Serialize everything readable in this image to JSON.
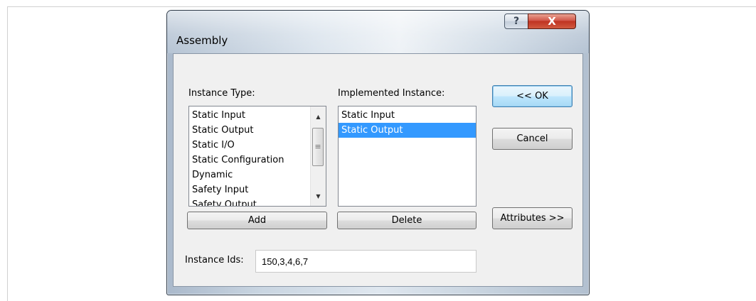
{
  "window": {
    "title": "Assembly",
    "help_label": "?",
    "close_label": "X"
  },
  "instance_type": {
    "label": "Instance Type:",
    "items": [
      "Static Input",
      "Static Output",
      "Static I/O",
      "Static Configuration",
      "Dynamic",
      "Safety Input",
      "Safety Output"
    ],
    "scroll_up": "▲",
    "scroll_down": "▼",
    "thumb_grip": "≡",
    "add_button": "Add"
  },
  "implemented_instance": {
    "label": "Implemented Instance:",
    "items": [
      "Static Input",
      "Static Output"
    ],
    "selected": "Static Output",
    "delete_button": "Delete"
  },
  "buttons": {
    "ok": "<< OK",
    "cancel": "Cancel",
    "attributes": "Attributes >>"
  },
  "instance_ids": {
    "label": "Instance Ids:",
    "value": "150,3,4,6,7"
  },
  "colors": {
    "selection": "#3399ff",
    "close_button": "#c4382a",
    "dialog_background": "#f0f0f0"
  }
}
